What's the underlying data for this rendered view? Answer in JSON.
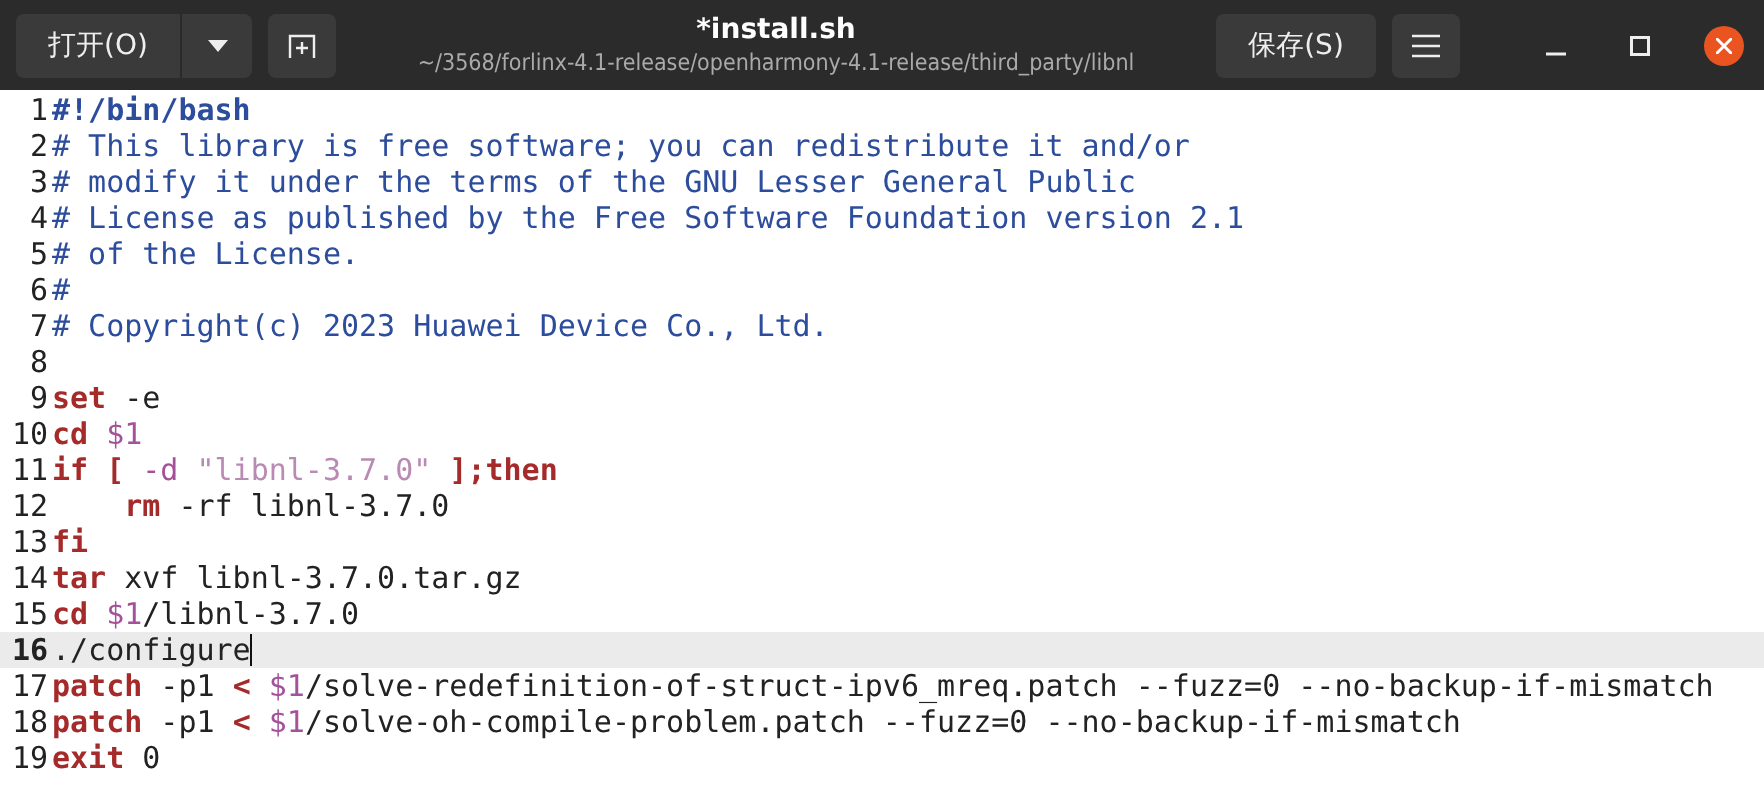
{
  "header": {
    "open_button": "打开(O)",
    "title": "*install.sh",
    "subtitle": "~/3568/forlinx-4.1-release/openharmony-4.1-release/third_party/libnl",
    "save_button": "保存(S)"
  },
  "lines": [
    {
      "number": "1",
      "current": false,
      "tokens": [
        {
          "kind": "shebang",
          "text": "#!/bin/bash"
        }
      ]
    },
    {
      "number": "2",
      "current": false,
      "tokens": [
        {
          "kind": "comment",
          "text": "# This library is free software; you can redistribute it and/or"
        }
      ]
    },
    {
      "number": "3",
      "current": false,
      "tokens": [
        {
          "kind": "comment",
          "text": "# modify it under the terms of the GNU Lesser General Public"
        }
      ]
    },
    {
      "number": "4",
      "current": false,
      "tokens": [
        {
          "kind": "comment",
          "text": "# License as published by the Free Software Foundation version 2.1"
        }
      ]
    },
    {
      "number": "5",
      "current": false,
      "tokens": [
        {
          "kind": "comment",
          "text": "# of the License."
        }
      ]
    },
    {
      "number": "6",
      "current": false,
      "tokens": [
        {
          "kind": "comment",
          "text": "#"
        }
      ]
    },
    {
      "number": "7",
      "current": false,
      "tokens": [
        {
          "kind": "comment",
          "text": "# Copyright(c) 2023 Huawei Device Co., Ltd."
        }
      ]
    },
    {
      "number": "8",
      "current": false
    },
    {
      "number": "9",
      "current": false,
      "tokens": [
        {
          "kind": "keyword",
          "text": "set"
        },
        {
          "kind": "plain",
          "text": " -e"
        }
      ]
    },
    {
      "number": "10",
      "current": false,
      "tokens": [
        {
          "kind": "keyword",
          "text": "cd"
        },
        {
          "kind": "variable",
          "text": " $1"
        }
      ]
    },
    {
      "number": "11",
      "current": false,
      "tokens": [
        {
          "kind": "keyword",
          "text": "if"
        },
        {
          "kind": "keyword",
          "text": " ["
        },
        {
          "kind": "variable",
          "text": " -d"
        },
        {
          "kind": "string",
          "text": " \"libnl-3.7.0\""
        },
        {
          "kind": "keyword",
          "text": " ];then"
        }
      ]
    },
    {
      "number": "12",
      "current": false,
      "tokens": [
        {
          "kind": "keyword",
          "text": "    rm"
        },
        {
          "kind": "plain",
          "text": " -rf libnl-3.7.0"
        }
      ]
    },
    {
      "number": "13",
      "current": false,
      "tokens": [
        {
          "kind": "keyword",
          "text": "fi"
        }
      ]
    },
    {
      "number": "14",
      "current": false,
      "tokens": [
        {
          "kind": "keyword",
          "text": "tar"
        },
        {
          "kind": "plain",
          "text": " xvf libnl-3.7.0.tar.gz"
        }
      ]
    },
    {
      "number": "15",
      "current": false,
      "tokens": [
        {
          "kind": "keyword",
          "text": "cd"
        },
        {
          "kind": "variable",
          "text": " $1"
        },
        {
          "kind": "plain",
          "text": "/libnl-3.7.0"
        }
      ]
    },
    {
      "number": "16",
      "current": true,
      "tokens": [
        {
          "kind": "plain",
          "text": "./configure"
        }
      ]
    },
    {
      "number": "17",
      "current": false,
      "tokens": [
        {
          "kind": "keyword",
          "text": "patch"
        },
        {
          "kind": "plain",
          "text": " -p1 "
        },
        {
          "kind": "keyword",
          "text": "<"
        },
        {
          "kind": "variable",
          "text": " $1"
        },
        {
          "kind": "plain",
          "text": "/solve-redefinition-of-struct-ipv6_mreq.patch --fuzz=0 --no-backup-if-mismatch"
        }
      ]
    },
    {
      "number": "18",
      "current": false,
      "tokens": [
        {
          "kind": "keyword",
          "text": "patch"
        },
        {
          "kind": "plain",
          "text": " -p1 "
        },
        {
          "kind": "keyword",
          "text": "<"
        },
        {
          "kind": "variable",
          "text": " $1"
        },
        {
          "kind": "plain",
          "text": "/solve-oh-compile-problem.patch --fuzz=0 --no-backup-if-mismatch"
        }
      ]
    },
    {
      "number": "19",
      "current": false,
      "tokens": [
        {
          "kind": "keyword",
          "text": "exit"
        },
        {
          "kind": "plain",
          "text": " 0"
        }
      ]
    }
  ]
}
